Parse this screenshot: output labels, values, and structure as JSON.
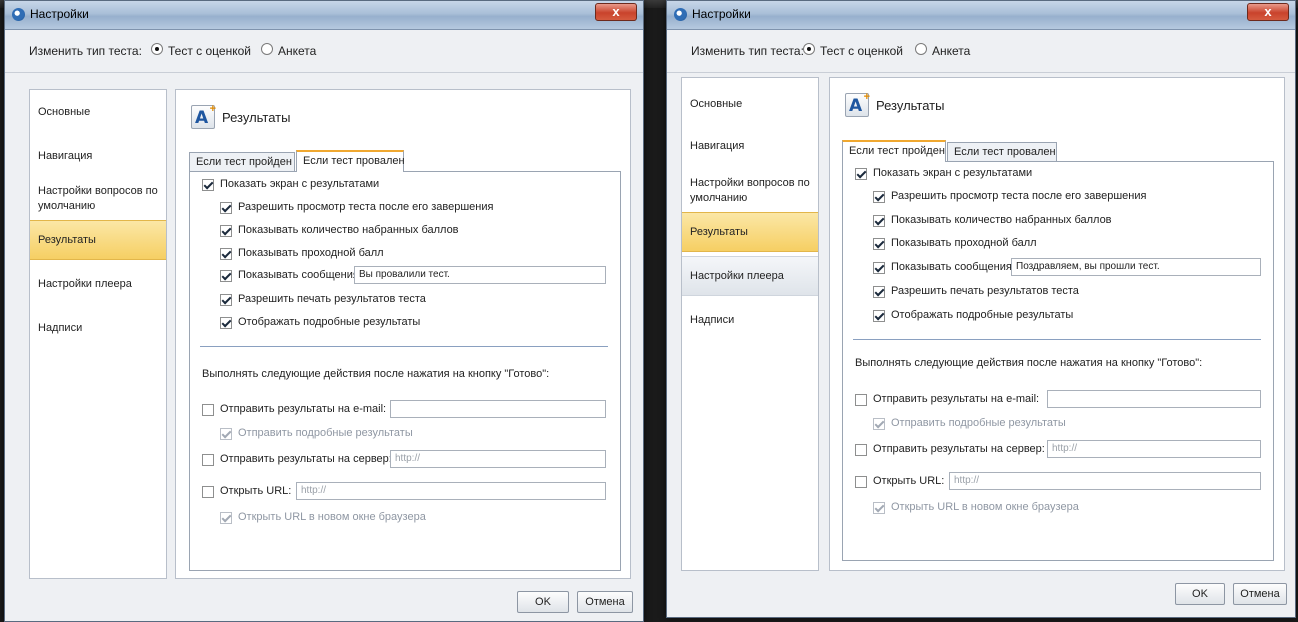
{
  "windows": [
    {
      "title": "Настройки",
      "close_label": "x",
      "test_type": {
        "label": "Изменить тип теста:",
        "options": [
          "Тест с оценкой",
          "Анкета"
        ],
        "selected": "Тест с оценкой"
      },
      "sidebar": {
        "items": [
          "Основные",
          "Навигация",
          "Настройки вопросов по умолчанию",
          "Результаты",
          "Настройки плеера",
          "Надписи"
        ],
        "active": "Результаты"
      },
      "section_title": "Результаты",
      "tabs": [
        "Если тест пройден",
        "Если тест провален"
      ],
      "active_tab": "Если тест провален",
      "show_results": {
        "label": "Показать экран с результатами",
        "checked": true
      },
      "options": [
        {
          "label": "Разрешить просмотр теста после его завершения",
          "checked": true
        },
        {
          "label": "Показывать количество набранных баллов",
          "checked": true
        },
        {
          "label": "Показывать проходной балл",
          "checked": true
        },
        {
          "label": "Показывать сообщения",
          "checked": true,
          "value": "Вы провалили тест."
        },
        {
          "label": "Разрешить печать результатов теста",
          "checked": true
        },
        {
          "label": "Отображать подробные результаты",
          "checked": true
        }
      ],
      "actions_label": "Выполнять следующие действия после нажатия на кнопку \"Готово\":",
      "email": {
        "label": "Отправить результаты на e-mail:",
        "checked": false,
        "value": ""
      },
      "email_details": {
        "label": "Отправить подробные результаты",
        "checked": true,
        "disabled": true
      },
      "server": {
        "label": "Отправить результаты на сервер:",
        "checked": false,
        "placeholder": "http://"
      },
      "url": {
        "label": "Открыть URL:",
        "checked": false,
        "placeholder": "http://"
      },
      "url_new_window": {
        "label": "Открыть URL в новом окне браузера",
        "checked": true,
        "disabled": true
      },
      "ok_label": "OK",
      "cancel_label": "Отмена"
    },
    {
      "title": "Настройки",
      "close_label": "x",
      "test_type": {
        "label": "Изменить тип теста:",
        "options": [
          "Тест с оценкой",
          "Анкета"
        ],
        "selected": "Тест с оценкой"
      },
      "sidebar": {
        "items": [
          "Основные",
          "Навигация",
          "Настройки вопросов по умолчанию",
          "Результаты",
          "Настройки плеера",
          "Надписи"
        ],
        "active": "Результаты",
        "hover": "Настройки плеера"
      },
      "section_title": "Результаты",
      "tabs": [
        "Если тест пройден",
        "Если тест провален"
      ],
      "active_tab": "Если тест пройден",
      "show_results": {
        "label": "Показать экран с результатами",
        "checked": true
      },
      "options": [
        {
          "label": "Разрешить просмотр теста после его завершения",
          "checked": true
        },
        {
          "label": "Показывать количество набранных баллов",
          "checked": true
        },
        {
          "label": "Показывать проходной балл",
          "checked": true
        },
        {
          "label": "Показывать сообщения",
          "checked": true,
          "value": "Поздравляем, вы прошли тест."
        },
        {
          "label": "Разрешить печать результатов теста",
          "checked": true
        },
        {
          "label": "Отображать подробные результаты",
          "checked": true
        }
      ],
      "actions_label": "Выполнять следующие действия после нажатия на кнопку \"Готово\":",
      "email": {
        "label": "Отправить результаты на e-mail:",
        "checked": false,
        "value": ""
      },
      "email_details": {
        "label": "Отправить подробные результаты",
        "checked": true,
        "disabled": true
      },
      "server": {
        "label": "Отправить результаты на сервер:",
        "checked": false,
        "placeholder": "http://"
      },
      "url": {
        "label": "Открыть URL:",
        "checked": false,
        "placeholder": "http://"
      },
      "url_new_window": {
        "label": "Открыть URL в новом окне браузера",
        "checked": true,
        "disabled": true
      },
      "ok_label": "OK",
      "cancel_label": "Отмена"
    }
  ]
}
